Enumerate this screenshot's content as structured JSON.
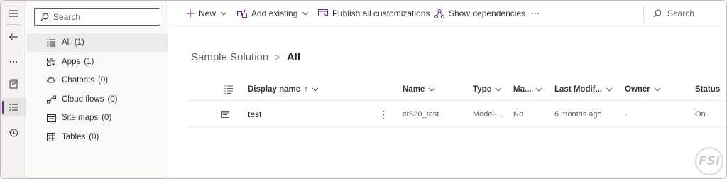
{
  "nav": {
    "search_placeholder": "Search",
    "items": [
      {
        "label": "All",
        "count": "(1)",
        "icon": "list-icon"
      },
      {
        "label": "Apps",
        "count": "(1)",
        "icon": "apps-icon"
      },
      {
        "label": "Chatbots",
        "count": "(0)",
        "icon": "chatbot-icon"
      },
      {
        "label": "Cloud flows",
        "count": "(0)",
        "icon": "flow-icon"
      },
      {
        "label": "Site maps",
        "count": "(0)",
        "icon": "sitemap-icon"
      },
      {
        "label": "Tables",
        "count": "(0)",
        "icon": "table-icon"
      }
    ]
  },
  "toolbar": {
    "new_label": "New",
    "add_existing_label": "Add existing",
    "publish_label": "Publish all customizations",
    "dependencies_label": "Show dependencies",
    "more_label": "···",
    "search_placeholder": "Search"
  },
  "breadcrumb": {
    "parent": "Sample Solution",
    "separator": ">",
    "current": "All"
  },
  "grid": {
    "columns": {
      "display_name": "Display name",
      "sort_indicator": "↑",
      "name": "Name",
      "type": "Type",
      "managed": "Ma...",
      "last_modified": "Last Modif...",
      "owner": "Owner",
      "status": "Status"
    },
    "rows": [
      {
        "display_name": "test",
        "more": "⋮",
        "name": "cr520_test",
        "type": "Model-...",
        "managed": "No",
        "last_modified": "6 months ago",
        "owner": "-",
        "status": "On"
      }
    ]
  },
  "watermark": "FSi",
  "colors": {
    "accent": "#6d2c83",
    "text": "#242424",
    "muted": "#605e5c"
  }
}
